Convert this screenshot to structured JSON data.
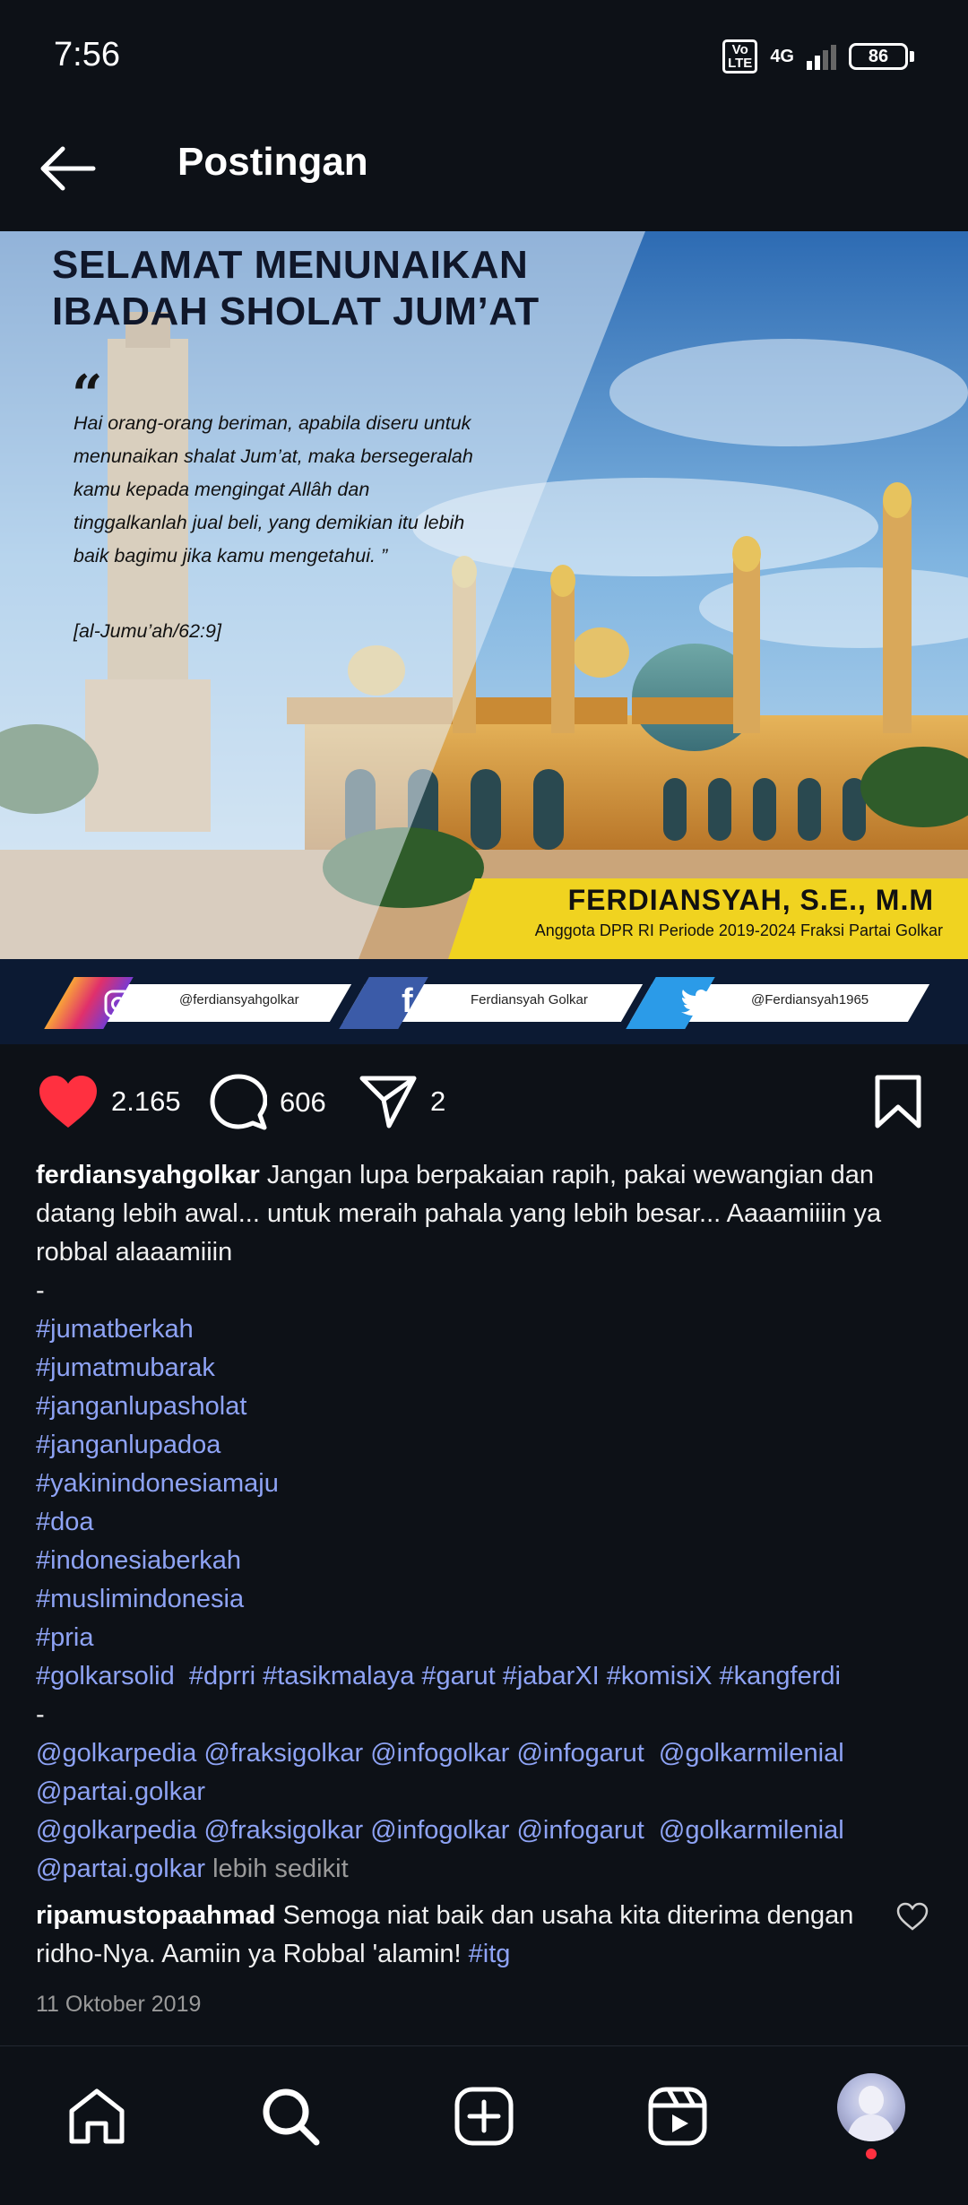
{
  "status_bar": {
    "time": "7:56",
    "volte": "Vo LTE",
    "network": "4G",
    "battery": "86"
  },
  "header": {
    "title": "Postingan"
  },
  "post_image": {
    "title_line1": "SELAMAT MENUNAIKAN",
    "title_line2": "IBADAH SHOLAT JUM’AT",
    "quote_mark_open": "“",
    "quote": "Hai orang-orang beriman, apabila diseru untuk menunaikan shalat Jum’at, maka bersegeralah kamu kepada mengingat Allâh dan tinggalkanlah jual beli, yang demikian itu lebih baik bagimu jika kamu mengetahui. ”",
    "reference": "[al-Jumu’ah/62:9]",
    "name": "FERDIANSYAH, S.E., M.M",
    "subtitle": "Anggota DPR RI Periode 2019-2024 Fraksi Partai Golkar",
    "social": {
      "instagram": "@ferdiansyahgolkar",
      "facebook": "Ferdiansyah Golkar",
      "twitter": "@Ferdiansyah1965"
    }
  },
  "actions": {
    "likes": "2.165",
    "comments": "606",
    "shares": "2"
  },
  "caption": {
    "username": "ferdiansyahgolkar",
    "text": "Jangan lupa berpakaian rapih, pakai wewangian dan datang lebih awal... untuk meraih pahala yang lebih besar... Aaaamiiiin ya robbal alaaamiiin",
    "dash1": "-",
    "hashtags": [
      "#jumatberkah",
      "#jumatmubarak",
      "#janganlupasholat",
      "#janganlupadoa",
      "#yakinindonesiamaju",
      "#doa",
      "#indonesiaberkah",
      "#muslimindonesia",
      "#pria"
    ],
    "hashtag_line": [
      "#golkarsolid",
      "#dprri",
      "#tasikmalaya",
      "#garut",
      "#jabarXI",
      "#komisiX",
      "#kangferdi"
    ],
    "dash2": "-",
    "mentions_a": [
      "@golkarpedia",
      "@fraksigolkar",
      "@infogolkar",
      "@infogarut",
      "@golkarmilenial"
    ],
    "mention_a_end": "@partai.golkar",
    "mentions_b": [
      "@golkarpedia",
      "@fraksigolkar",
      "@infogolkar",
      "@infogarut",
      "@golkarmilenial"
    ],
    "mention_b_end": "@partai.golkar",
    "less": "lebih sedikit"
  },
  "comment": {
    "username": "ripamustopaahmad",
    "text": "Semoga niat baik dan usaha kita diterima dengan ridho-Nya. Aamiin ya Robbal 'alamin!",
    "tag": "#itg"
  },
  "date": "11 Oktober 2019",
  "icons": {
    "back": "arrow-left-icon",
    "like": "heart-icon",
    "comment": "comment-bubble-icon",
    "share": "paper-plane-icon",
    "save": "bookmark-icon",
    "home": "home-icon",
    "search": "search-icon",
    "create": "plus-square-icon",
    "reels": "reels-icon"
  },
  "colors": {
    "background": "#0d1117",
    "link": "#8ea3f5",
    "like": "#ff3040",
    "banner_yellow": "#f0d320"
  }
}
